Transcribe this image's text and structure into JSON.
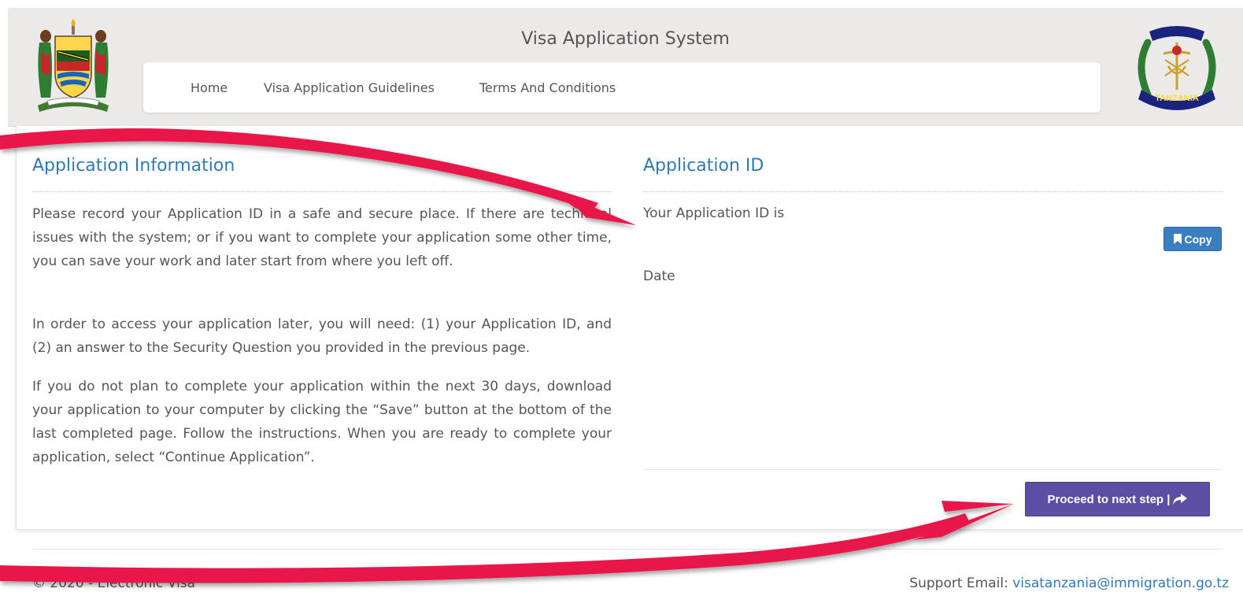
{
  "header": {
    "title": "Visa Application System",
    "logo_left_icon": "tanzania-coat-of-arms-icon",
    "logo_right_icon": "immigration-emblem-icon",
    "logo_right_text": "TANZANIA",
    "nav": [
      {
        "label": "Home"
      },
      {
        "label": "Visa Application Guidelines"
      },
      {
        "label": "Terms And Conditions"
      }
    ]
  },
  "left_section": {
    "title": "Application Information",
    "paragraphs": [
      "Please record your Application ID in a safe and secure place. If there are technical issues with the system; or if you want to complete your application some other time, you can save your work and later start from where you left off.",
      "In order to access your application later, you will need: (1) your Application ID, and (2) an answer to the Security Question you provided in the previous page.",
      "If you do not plan to complete your application within the next 30 days, download your application to your computer by clicking the “Save” button at the bottom of the last completed page. Follow the instructions. When you are ready to complete your application, select “Continue Application”."
    ]
  },
  "right_section": {
    "title": "Application ID",
    "id_label": "Your Application ID is",
    "copy_label": "Copy",
    "date_label": "Date"
  },
  "actions": {
    "proceed_label": "Proceed to next step |"
  },
  "footer": {
    "left_text": "© 2020 - Electronic Visa",
    "support_label": "Support Email: ",
    "support_email": "visatanzania@immigration.go.tz"
  },
  "colors": {
    "accent_blue": "#2f79b9",
    "copy_button": "#3a7ec0",
    "proceed_button": "#5c4fa3",
    "header_bg": "#ece9e9",
    "annotation_arrow": "#e8194a"
  }
}
